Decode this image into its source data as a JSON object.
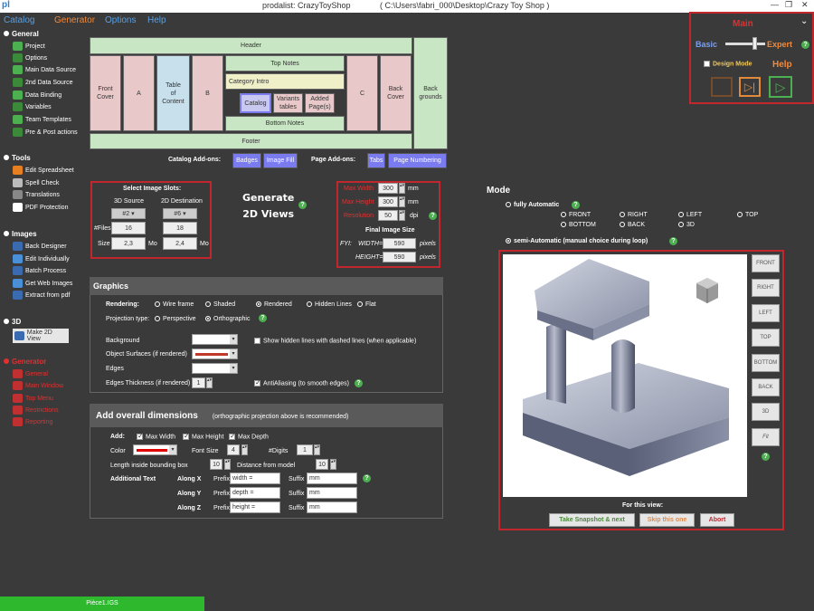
{
  "titlebar": {
    "app": "pl",
    "title": "prodalist: CrazyToyShop",
    "path": "( C:\\Users\\fabri_000\\Desktop\\Crazy Toy Shop )"
  },
  "menu": {
    "catalog": "Catalog",
    "generator": "Generator",
    "options": "Options",
    "help": "Help"
  },
  "sidebar": {
    "general": "General",
    "general_items": [
      "Project",
      "Options",
      "Main Data Source",
      "2nd Data Source",
      "Data Binding",
      "Variables",
      "Team Templates",
      "Pre & Post actions"
    ],
    "tools": "Tools",
    "tools_items": [
      "Edit Spreadsheet",
      "Spell Check",
      "Translations",
      "PDF Protection"
    ],
    "images": "Images",
    "images_items": [
      "Back Designer",
      "Edit Individually",
      "Batch Process",
      "Get Web Images",
      "Extract from pdf"
    ],
    "threed": "3D",
    "threed_items": [
      "Make 2D View"
    ],
    "generator": "Generator",
    "generator_items": [
      "General",
      "Main Window",
      "Top Menu",
      "Restrictions",
      "Reporting"
    ]
  },
  "layout": {
    "header": "Header",
    "top_notes": "Top Notes",
    "front_cover": "Front\nCover",
    "a": "A",
    "toc": "Table\nof\nContent",
    "b": "B",
    "category_intro": "Category Intro",
    "catalog": "Catalog",
    "variants": "Variants\ntables",
    "added": "Added\nPage(s)",
    "c": "C",
    "back_cover": "Back\nCover",
    "backgrounds": "Back\ngrounds",
    "bottom_notes": "Bottom Notes",
    "footer": "Footer"
  },
  "addons": {
    "catalog_label": "Catalog Add-ons:",
    "badges": "Badges",
    "image_fill": "Image Fill",
    "page_label": "Page Add-ons:",
    "tabs": "Tabs",
    "page_numbering": "Page Numbering"
  },
  "slots": {
    "title": "Select Image Slots:",
    "src": "3D Source",
    "dst": "2D Destination",
    "src_val": "#2",
    "dst_val": "#6",
    "files_label": "#Files",
    "files_src": "16",
    "files_dst": "18",
    "size_label": "Size",
    "size_src": "2,3",
    "size_dst": "2,4",
    "unit": "Mo"
  },
  "generate": {
    "line1": "Generate",
    "line2": "2D Views"
  },
  "dims": {
    "maxw_label": "Max Width",
    "maxw": "300",
    "maxh_label": "Max Height",
    "maxh": "300",
    "res_label": "Resolution",
    "res": "50",
    "mm": "mm",
    "dpi": "dpi",
    "final": "Final Image Size",
    "fyi": "FYI:",
    "width_label": "WIDTH=",
    "width": "590",
    "height_label": "HEIGHT=",
    "height": "590",
    "pixels": "pixels"
  },
  "graphics": {
    "title": "Graphics",
    "rendering": "Rendering:",
    "r_opts": [
      "Wire frame",
      "Shaded",
      "Rendered",
      "Hidden Lines",
      "Flat"
    ],
    "proj": "Projection type:",
    "p_opts": [
      "Perspective",
      "Orthographic"
    ],
    "bg": "Background",
    "obj": "Object Surfaces (if rendered)",
    "edges": "Edges",
    "thick": "Edges Thickness (if rendered)",
    "thick_val": "1",
    "show_hidden": "Show hidden lines with dashed lines (when applicable)",
    "aa": "AntiAliasing (to smooth edges)",
    "obj_color": "#c0392b"
  },
  "overall": {
    "title": "Add overall dimensions",
    "note": "(orthographic projection above is recommended)",
    "add": "Add:",
    "maxw": "Max Width",
    "maxh": "Max Height",
    "maxd": "Max Depth",
    "color": "Color",
    "color_val": "#e00000",
    "fontsize": "Font Size",
    "fontsize_val": "4",
    "digits": "#Digits",
    "digits_val": "1",
    "len": "Length inside bounding box",
    "len_val": "10",
    "dist": "Distance from model",
    "dist_val": "10",
    "addtext": "Additional Text",
    "rows": [
      {
        "axis": "Along X",
        "prefix": "width =",
        "suffix": "mm"
      },
      {
        "axis": "Along Y",
        "prefix": "depth =",
        "suffix": "mm"
      },
      {
        "axis": "Along Z",
        "prefix": "height =",
        "suffix": "mm"
      }
    ],
    "prefix": "Prefix",
    "suffix": "Suffix"
  },
  "mode": {
    "title": "Mode",
    "full": "fully Automatic",
    "views": [
      "FRONT",
      "RIGHT",
      "LEFT",
      "TOP",
      "BOTTOM",
      "BACK",
      "3D"
    ],
    "semi": "semi-Automatic (manual choice during loop)"
  },
  "viewer": {
    "buttons": [
      "FRONT",
      "RIGHT",
      "LEFT",
      "TOP",
      "BOTTOM",
      "BACK",
      "3D",
      "Fit"
    ],
    "for_view": "For this view:",
    "snapshot": "Take Snapshot & next",
    "skip": "Skip this one",
    "abort": "Abort"
  },
  "control": {
    "main": "Main",
    "basic": "Basic",
    "expert": "Expert",
    "design": "Design Mode",
    "help": "Help"
  },
  "status": {
    "file": "Pièce1.IGS"
  }
}
